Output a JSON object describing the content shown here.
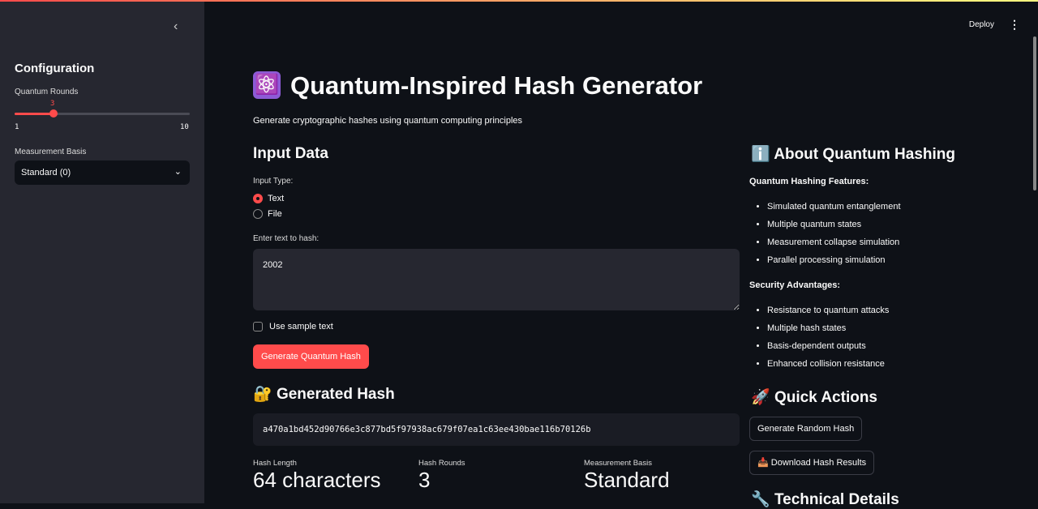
{
  "header": {
    "deploy_label": "Deploy",
    "menu_icon": "kebab-menu-icon"
  },
  "sidebar": {
    "title": "Configuration",
    "rounds_label": "Quantum Rounds",
    "rounds_value": "3",
    "rounds_min": "1",
    "rounds_max": "10",
    "rounds_fraction": 0.2222,
    "basis_label": "Measurement Basis",
    "basis_value": "Standard (0)"
  },
  "page": {
    "title": "Quantum-Inspired Hash Generator",
    "title_icon": "⚛️",
    "subtitle": "Generate cryptographic hashes using quantum computing principles"
  },
  "input": {
    "heading": "Input Data",
    "type_label": "Input Type:",
    "options": [
      "Text",
      "File"
    ],
    "selected": "Text",
    "text_label": "Enter text to hash:",
    "text_value": "2002",
    "sample_label": "Use sample text",
    "generate_label": "Generate Quantum Hash"
  },
  "result": {
    "heading": "Generated Hash",
    "icon": "🔐",
    "hash": "a470a1bd452d90766e3c877bd5f97938ac679f07ea1c63ee430bae116b70126b",
    "metrics": [
      {
        "label": "Hash Length",
        "value": "64 characters"
      },
      {
        "label": "Hash Rounds",
        "value": "3"
      },
      {
        "label": "Measurement Basis",
        "value": "Standard"
      }
    ]
  },
  "about": {
    "heading": "About Quantum Hashing",
    "icon": "ℹ️",
    "features_title": "Quantum Hashing Features:",
    "features": [
      "Simulated quantum entanglement",
      "Multiple quantum states",
      "Measurement collapse simulation",
      "Parallel processing simulation"
    ],
    "security_title": "Security Advantages:",
    "security": [
      "Resistance to quantum attacks",
      "Multiple hash states",
      "Basis-dependent outputs",
      "Enhanced collision resistance"
    ]
  },
  "quick": {
    "heading": "Quick Actions",
    "icon": "🚀",
    "random_label": "Generate Random Hash",
    "download_label": "Download Hash Results",
    "download_icon": "📥"
  },
  "tech": {
    "heading": "Technical Details",
    "icon": "🔧"
  },
  "colors": {
    "accent": "#ff4b4b",
    "sidebar_bg": "#262730",
    "main_bg": "#0e1117"
  }
}
